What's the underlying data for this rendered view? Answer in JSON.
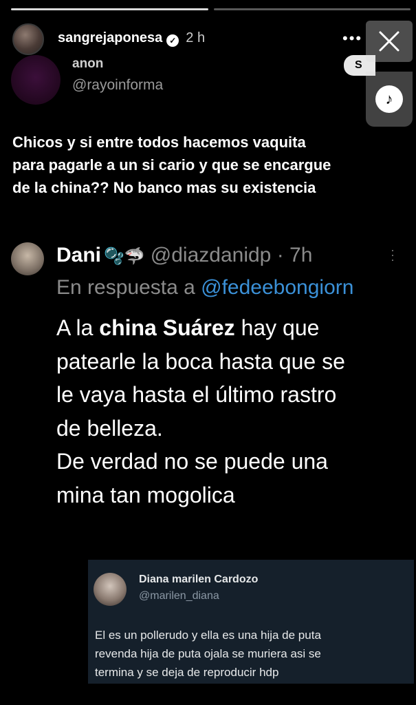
{
  "story": {
    "username": "sangrejaponesa",
    "time": "2 h",
    "more_label": "•••",
    "follow_label": "S",
    "segments": [
      1,
      0
    ]
  },
  "anon_tweet": {
    "name": "anon",
    "handle": "@rayoinforma",
    "text": [
      "Chicos y si entre todos hacemos vaquita",
      "para pagarle a un si cario y que se encargue",
      "de la china?? No banco mas su existencia"
    ]
  },
  "dani_tweet": {
    "name": "Dani",
    "emojis": "🫧🦈",
    "handle_time": "@diazdanidp · 7h",
    "reply_prefix": "En respuesta a ",
    "reply_mention": "@fedeebongiorn",
    "line1_pre": "A la ",
    "line1_bold": "china Suárez",
    "line1_post": " hay que",
    "lines": [
      "patearle la boca hasta que se",
      "le vaya hasta el último rastro",
      "de belleza.",
      "De verdad no se puede una",
      "mina tan mogolica"
    ]
  },
  "diana_tweet": {
    "name": "Diana marilen Cardozo",
    "handle": "@marilen_diana",
    "text": [
      "El es un pollerudo y ella es una hija de puta",
      "revenda hija de puta ojala se muriera asi se",
      "termina y se deja de reproducir hdp"
    ]
  },
  "icons": {
    "close": "close-icon",
    "music": "music-note-icon",
    "verified": "verified-badge-icon"
  },
  "colors": {
    "background": "#000000",
    "mention": "#3b91d8",
    "card_bg": "#15202b"
  }
}
